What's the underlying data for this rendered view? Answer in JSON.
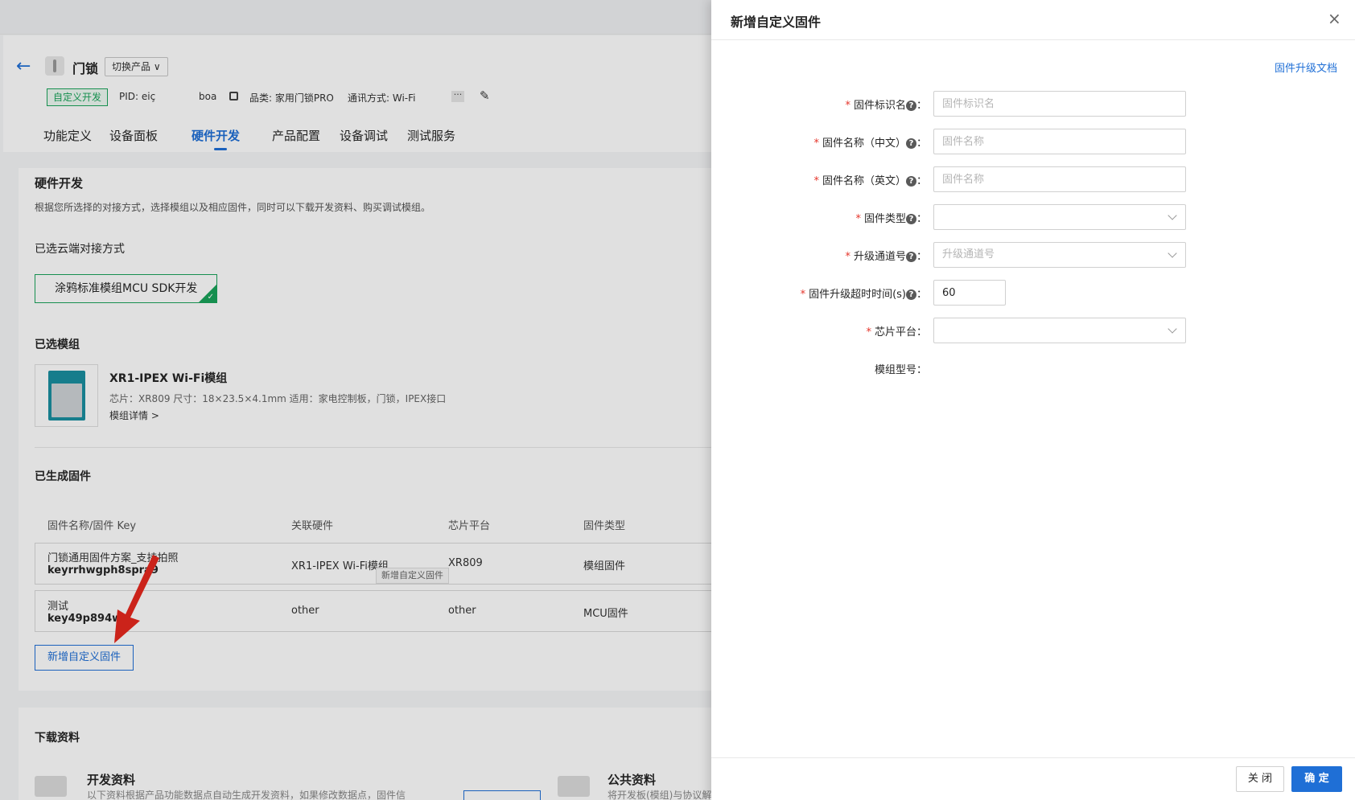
{
  "app": {
    "product_name": "门锁",
    "switch_product": "切换产品",
    "tag_custom": "自定义开发",
    "pid_label": "PID: eiç",
    "pid_suffix": "boa",
    "category": "品类: 家用门锁PRO",
    "protocol": "通讯方式: Wi-Fi",
    "more": "···"
  },
  "tabs": [
    {
      "label": "功能定义"
    },
    {
      "label": "设备面板"
    },
    {
      "label": "硬件开发"
    },
    {
      "label": "产品配置"
    },
    {
      "label": "设备调试"
    },
    {
      "label": "测试服务"
    }
  ],
  "hardware": {
    "title": "硬件开发",
    "desc": "根据您所选择的对接方式，选择模组以及相应固件，同时可以下载开发资料、购买调试模组。",
    "cloud_title": "已选云端对接方式",
    "sdk_option": "涂鸦标准模组MCU SDK开发",
    "module_title": "已选模组",
    "module_name": "XR1-IPEX Wi-Fi模组",
    "module_spec": "芯片：XR809    尺寸：18×23.5×4.1mm    适用：家电控制板，门锁，IPEX接口",
    "module_link": "模组详情 >",
    "firmware_title": "已生成固件",
    "columns": [
      "固件名称/固件 Key",
      "关联硬件",
      "芯片平台",
      "固件类型"
    ],
    "rows": [
      {
        "name": "门锁通用固件方案_支持拍照",
        "key": "keyrrhwgph8spra9",
        "hw": "XR1-IPEX Wi-Fi模组",
        "chip": "XR809",
        "type": "模组固件"
      },
      {
        "name": "测试",
        "key": "key49p894wg",
        "hw": "other",
        "chip": "other",
        "type": "MCU固件"
      }
    ],
    "tooltip": "新增自定义固件",
    "add_button": "新增自定义固件"
  },
  "downloads": {
    "title": "下载资料",
    "dev_title": "开发资料",
    "dev_desc": "以下资料根据产品功能数据点自动生成开发资料，如果修改数据点，固件信",
    "public_title": "公共资料",
    "public_desc": "将开发板(模组)与协议解"
  },
  "drawer": {
    "title": "新增自定义固件",
    "close_icon": "×",
    "doc_link": "固件升级文档",
    "fields": [
      {
        "label": "固件标识名",
        "placeholder": "固件标识名",
        "help": "?"
      },
      {
        "label": "固件名称（中文）",
        "placeholder": "固件名称",
        "help": "?"
      },
      {
        "label": "固件名称（英文）",
        "placeholder": "固件名称",
        "help": "?"
      },
      {
        "label": "固件类型",
        "placeholder": "",
        "help": "?"
      },
      {
        "label": "升级通道号",
        "placeholder": "升级通道号",
        "help": "?"
      },
      {
        "label": "固件升级超时时间(s)",
        "value": "60",
        "help": "?"
      },
      {
        "label": "芯片平台",
        "placeholder": ""
      },
      {
        "label": "模组型号"
      }
    ],
    "required_mark": "*",
    "colon": "：",
    "cancel": "关 闭",
    "confirm": "确 定"
  },
  "colors": {
    "primary": "#1f6fd6",
    "success": "#1aa35a",
    "required": "#e5352b"
  }
}
